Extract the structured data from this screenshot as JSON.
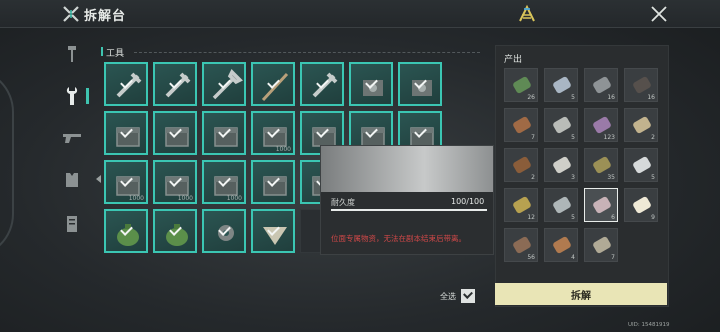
{
  "header": {
    "title": "拆解台"
  },
  "section": {
    "label": "工具"
  },
  "grid": {
    "rows": [
      [
        {
          "icon": "tool-icon",
          "selected": true,
          "count": ""
        },
        {
          "icon": "tool-icon",
          "selected": true,
          "count": ""
        },
        {
          "icon": "wrench-icon",
          "selected": true,
          "count": ""
        },
        {
          "icon": "rod-icon",
          "selected": true,
          "count": ""
        },
        {
          "icon": "tool-icon",
          "selected": true,
          "count": ""
        },
        {
          "icon": "machine-icon",
          "selected": true,
          "count": ""
        },
        {
          "icon": "machine-icon",
          "selected": true,
          "count": ""
        }
      ],
      [
        {
          "icon": "box-icon",
          "selected": true,
          "count": ""
        },
        {
          "icon": "box-icon",
          "selected": true,
          "count": ""
        },
        {
          "icon": "box-icon",
          "selected": true,
          "count": ""
        },
        {
          "icon": "box-icon",
          "selected": true,
          "count": "1000"
        },
        {
          "icon": "box-icon",
          "selected": true,
          "count": ""
        },
        {
          "icon": "box-icon",
          "selected": true,
          "count": ""
        },
        {
          "icon": "box-icon",
          "selected": true,
          "count": ""
        }
      ],
      [
        {
          "icon": "box-icon",
          "selected": true,
          "count": "1000"
        },
        {
          "icon": "box-icon",
          "selected": true,
          "count": "1000"
        },
        {
          "icon": "box-icon",
          "selected": true,
          "count": "1000"
        },
        {
          "icon": "box-icon",
          "selected": true,
          "count": ""
        },
        {
          "icon": "box-icon",
          "selected": true,
          "count": ""
        },
        {
          "icon": "box-icon",
          "selected": true,
          "count": ""
        },
        {
          "icon": "box-icon",
          "selected": true,
          "count": ""
        }
      ],
      [
        {
          "icon": "sack-icon",
          "selected": true,
          "count": ""
        },
        {
          "icon": "sack-icon",
          "selected": true,
          "count": ""
        },
        {
          "icon": "gear-icon",
          "selected": true,
          "count": ""
        },
        {
          "icon": "kite-icon",
          "selected": true,
          "count": ""
        },
        {
          "icon": "",
          "selected": false,
          "count": ""
        },
        {
          "icon": "",
          "selected": false,
          "count": ""
        },
        {
          "icon": "",
          "selected": false,
          "count": ""
        }
      ]
    ]
  },
  "tooltip": {
    "durability_label": "耐久度",
    "durability_value": "100/100",
    "durability_fraction": 1.0,
    "message": "位面专属物资，无法在剧本结束后带离。"
  },
  "select_all": {
    "label": "全选",
    "checked": true
  },
  "output": {
    "title": "产出",
    "items": [
      {
        "icon": "cash-icon",
        "qty": "26",
        "color": "#5f8a55",
        "selected": false
      },
      {
        "icon": "can-icon",
        "qty": "5",
        "color": "#a9b6c4",
        "selected": false
      },
      {
        "icon": "wire-icon",
        "qty": "16",
        "color": "#8e9396",
        "selected": false
      },
      {
        "icon": "parts-icon",
        "qty": "16",
        "color": "#56504c",
        "selected": false
      },
      {
        "icon": "wood-icon",
        "qty": "7",
        "color": "#a06a45",
        "selected": false
      },
      {
        "icon": "powder-icon",
        "qty": "5",
        "color": "#b9bcb8",
        "selected": false
      },
      {
        "icon": "battery-icon",
        "qty": "123",
        "color": "#9a7aa8",
        "selected": false
      },
      {
        "icon": "rock-icon",
        "qty": "2",
        "color": "#c2b38e",
        "selected": false
      },
      {
        "icon": "bottle-icon",
        "qty": "2",
        "color": "#8a5d3a",
        "selected": false
      },
      {
        "icon": "pipe-icon",
        "qty": "3",
        "color": "#cfcfc9",
        "selected": false
      },
      {
        "icon": "pile-icon",
        "qty": "35",
        "color": "#9b9056",
        "selected": false
      },
      {
        "icon": "sheet-icon",
        "qty": "5",
        "color": "#d6d9da",
        "selected": false
      },
      {
        "icon": "gold-icon",
        "qty": "12",
        "color": "#b7a150",
        "selected": false
      },
      {
        "icon": "cup-icon",
        "qty": "5",
        "color": "#aeb6b8",
        "selected": false
      },
      {
        "icon": "crystal-icon",
        "qty": "6",
        "color": "#c8b2b7",
        "selected": true
      },
      {
        "icon": "bag-icon",
        "qty": "9",
        "color": "#efe9d6",
        "selected": false
      },
      {
        "icon": "axe-icon",
        "qty": "56",
        "color": "#8b6b55",
        "selected": false
      },
      {
        "icon": "plank-icon",
        "qty": "4",
        "color": "#b07a4f",
        "selected": false
      },
      {
        "icon": "dust-icon",
        "qty": "7",
        "color": "#b0aa96",
        "selected": false
      }
    ]
  },
  "dismantle_button": {
    "label": "拆解"
  },
  "uid": "UID: 15481919"
}
